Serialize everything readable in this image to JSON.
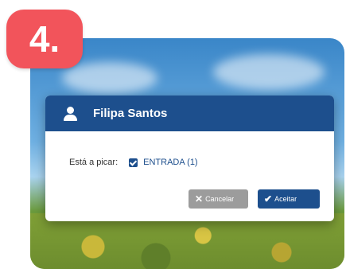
{
  "step_badge": "4.",
  "dialog": {
    "title": "Filipa Santos",
    "picking_label": "Está a picar:",
    "option_label": "ENTRADA (1)",
    "option_checked": true
  },
  "buttons": {
    "cancel_label": "Cancelar",
    "accept_label": "Aceitar"
  },
  "colors": {
    "header": "#1d4f8d",
    "badge": "#f2545b",
    "cancel": "#9c9c9c",
    "accept": "#1d4f8d"
  },
  "icons": {
    "user": "user-icon",
    "checkbox": "checkbox-checked-icon",
    "cancel": "x-icon",
    "accept": "check-icon"
  }
}
